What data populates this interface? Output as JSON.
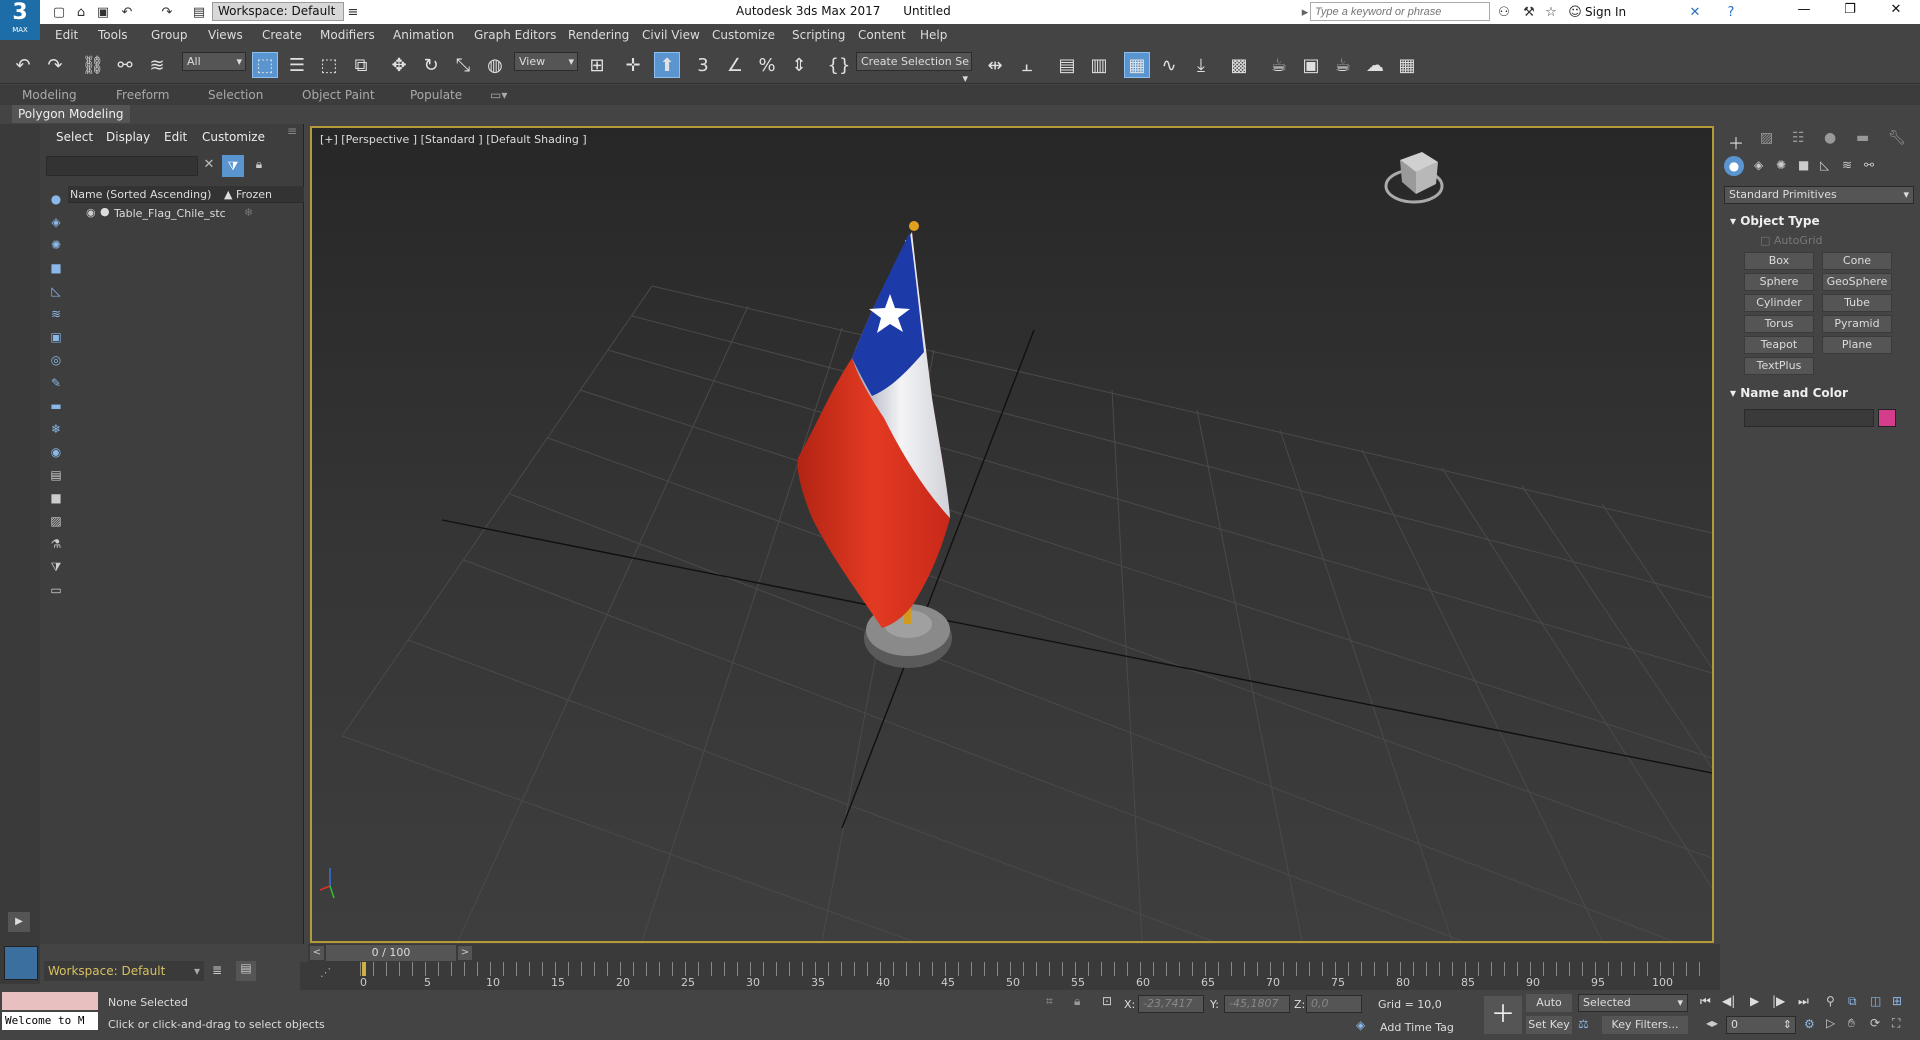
{
  "titlebar": {
    "app_title": "Autodesk 3ds Max 2017",
    "document": "Untitled",
    "workspace": "Workspace: Default",
    "search_placeholder": "Type a keyword or phrase",
    "sign_in": "Sign In"
  },
  "logo": {
    "number": "3",
    "caption": "MAX"
  },
  "menus": [
    "Edit",
    "Tools",
    "Group",
    "Views",
    "Create",
    "Modifiers",
    "Animation",
    "Graph Editors",
    "Rendering",
    "Civil View",
    "Customize",
    "Scripting",
    "Content",
    "Help"
  ],
  "toolbar": {
    "filter": "All",
    "view": "View",
    "create_selection_set": "Create Selection Se",
    "angle_snap": "3"
  },
  "ribbon": {
    "tabs": [
      "Modeling",
      "Freeform",
      "Selection",
      "Object Paint",
      "Populate"
    ],
    "panel": "Polygon Modeling"
  },
  "scene_explorer": {
    "tabs": [
      "Select",
      "Display",
      "Edit",
      "Customize"
    ],
    "column_name": "Name (Sorted Ascending)",
    "column_frozen": "▲ Frozen",
    "objects": [
      "Table_Flag_Chile_stc"
    ]
  },
  "viewport": {
    "label": "[+] [Perspective ] [Standard ] [Default Shading ]"
  },
  "command_panel": {
    "category": "Standard Primitives",
    "object_type_title": "Object Type",
    "autogrid": "AutoGrid",
    "buttons": [
      "Box",
      "Cone",
      "Sphere",
      "GeoSphere",
      "Cylinder",
      "Tube",
      "Torus",
      "Pyramid",
      "Teapot",
      "Plane",
      "TextPlus"
    ],
    "name_color_title": "Name and Color",
    "color": "#d63c8c"
  },
  "timeline": {
    "frame": "0 / 100",
    "ticks": [
      "0",
      "5",
      "10",
      "15",
      "20",
      "25",
      "30",
      "35",
      "40",
      "45",
      "50",
      "55",
      "60",
      "65",
      "70",
      "75",
      "80",
      "85",
      "90",
      "95",
      "100"
    ]
  },
  "status": {
    "workspace": "Workspace: Default",
    "listener": "Welcome to M",
    "selection": "None Selected",
    "prompt": "Click or click-and-drag to select objects",
    "x_label": "X:",
    "x_value": "-23,7417",
    "y_label": "Y:",
    "y_value": "-45,1807",
    "z_label": "Z:",
    "z_value": "0,0",
    "grid": "Grid = 10,0",
    "add_time_tag": "Add Time Tag",
    "auto_key": "Auto Key",
    "set_key": "Set Key",
    "selected": "Selected",
    "key_filters": "Key Filters...",
    "frame_field": "0"
  },
  "colors": {
    "viewport_bg": "#2f2f2f",
    "active_border": "#b59a3a",
    "flag_red": "#d5301e",
    "flag_blue": "#1c3aa8",
    "accent": "#5a95d0"
  }
}
